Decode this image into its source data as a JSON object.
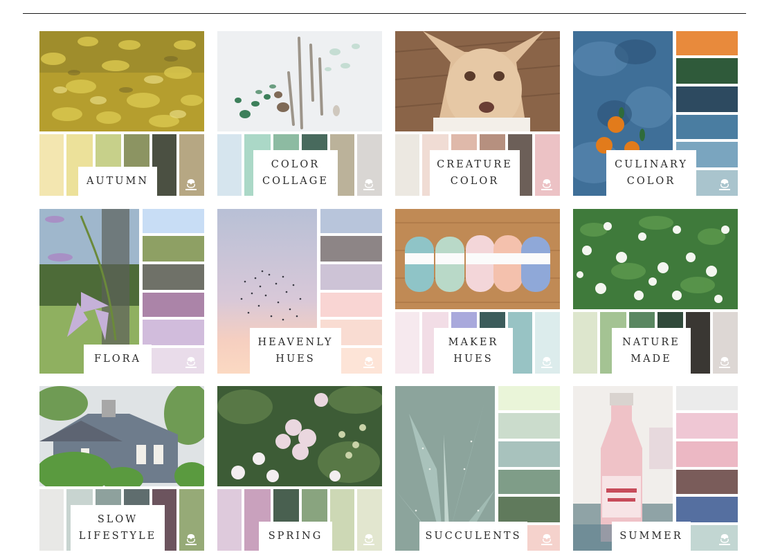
{
  "collections": [
    {
      "label_lines": [
        "AUTUMN"
      ],
      "swatches": [
        "#f3e6b0",
        "#ece19a",
        "#c7d08a",
        "#8c9462",
        "#4b5042",
        "#b6a783"
      ]
    },
    {
      "label_lines": [
        "COLOR",
        "COLLAGE"
      ],
      "swatches": [
        "#d6e5ee",
        "#abd8c7",
        "#8dbba2",
        "#486a5d",
        "#bbb29a",
        "#d9d6d3"
      ]
    },
    {
      "label_lines": [
        "CREATURE",
        "COLOR"
      ],
      "swatches": [
        "#ece8e1",
        "#f0dcd4",
        "#dfb9aa",
        "#b6907f",
        "#6c5f58",
        "#ecc2c5"
      ]
    },
    {
      "label_lines": [
        "CULINARY",
        "COLOR"
      ],
      "swatches": [
        "#e88a3c",
        "#2f5a3a",
        "#2d4a60",
        "#4a7da1",
        "#7aa5bf",
        "#a9c4cd"
      ]
    },
    {
      "label_lines": [
        "FLORA"
      ],
      "swatches": [
        "#c8ddf5",
        "#8ea064",
        "#6f7168",
        "#ab84a8",
        "#d1bcdc",
        "#e9dcea"
      ]
    },
    {
      "label_lines": [
        "HEAVENLY",
        "HUES"
      ],
      "swatches": [
        "#b8c5db",
        "#8d8586",
        "#cdc3d6",
        "#f9d5d3",
        "#f9dcd2",
        "#fde4d7"
      ]
    },
    {
      "label_lines": [
        "MAKER",
        "HUES"
      ],
      "swatches": [
        "#f6e9ee",
        "#f2dde6",
        "#a9a9dc",
        "#3c5c5b",
        "#98c3c4",
        "#dcecec"
      ]
    },
    {
      "label_lines": [
        "NATURE",
        "MADE"
      ],
      "swatches": [
        "#dde6cd",
        "#a4c393",
        "#5a8761",
        "#30493a",
        "#3a3733",
        "#ddd7d4"
      ]
    },
    {
      "label_lines": [
        "SLOW",
        "LIFESTYLE"
      ],
      "swatches": [
        "#e8e8e6",
        "#c8d4d0",
        "#8ea19d",
        "#5f6d6e",
        "#6c545e",
        "#96aa77"
      ]
    },
    {
      "label_lines": [
        "SPRING"
      ],
      "swatches": [
        "#decadc",
        "#c9a1bd",
        "#496050",
        "#89a47f",
        "#cdd8b5",
        "#e2e6cf"
      ]
    },
    {
      "label_lines": [
        "SUCCULENTS"
      ],
      "swatches": [
        "#eaf5d9",
        "#cbdccc",
        "#a8c2bd",
        "#7f9d88",
        "#607a5c",
        "#f5d2cc"
      ]
    },
    {
      "label_lines": [
        "SUMMER"
      ],
      "swatches": [
        "#ebebeb",
        "#efc7d4",
        "#ecb8c4",
        "#7a5c5a",
        "#556fa0",
        "#c2d6d2"
      ]
    }
  ]
}
